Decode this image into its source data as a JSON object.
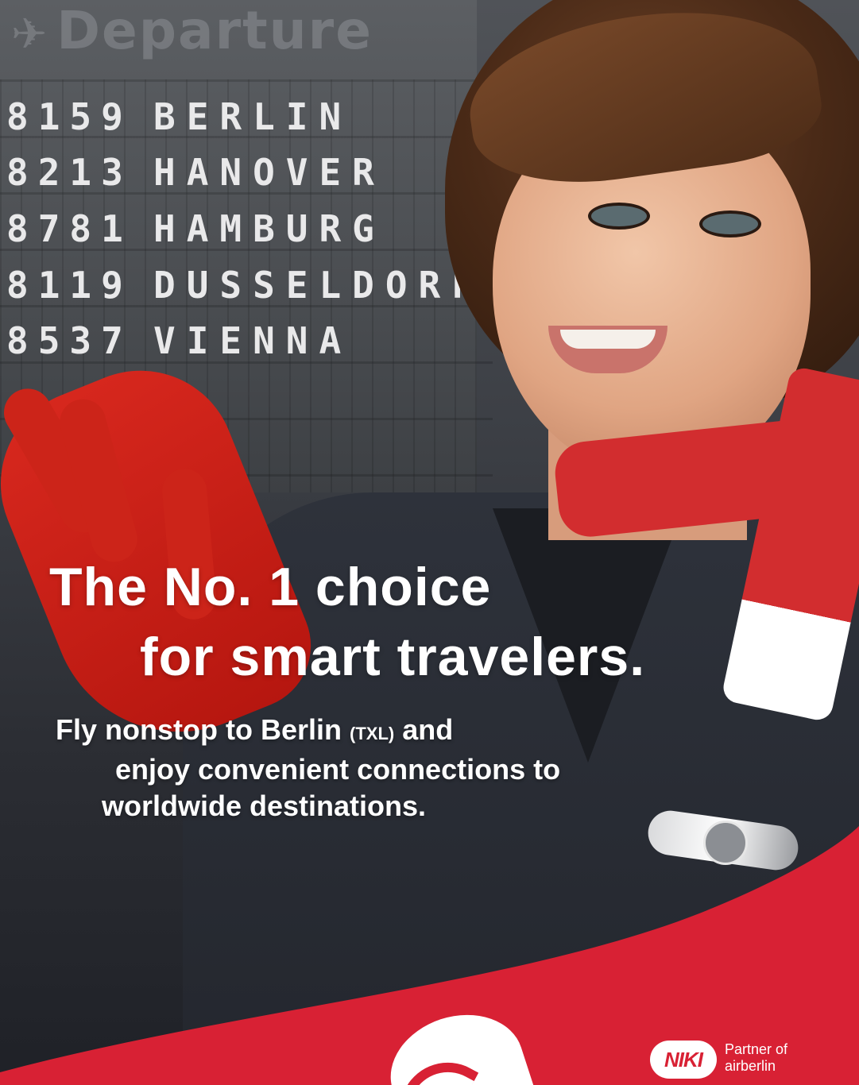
{
  "board": {
    "title": "Departure",
    "rows": [
      {
        "code": "8159",
        "city": "BERLIN"
      },
      {
        "code": "8213",
        "city": "HANOVER"
      },
      {
        "code": "8781",
        "city": "HAMBURG"
      },
      {
        "code": "8119",
        "city": "DUSSELDORF"
      },
      {
        "code": "8537",
        "city": "VIENNA"
      }
    ]
  },
  "headline": {
    "line1": "The No. 1 choice",
    "line2": "for smart travelers."
  },
  "subtext": {
    "line1_a": "Fly nonstop to Berlin",
    "line1_b": "(TXL)",
    "line1_c": "and",
    "line2": "enjoy convenient connections to",
    "line3": "worldwide destinations."
  },
  "brand": {
    "niki_logo_text": "NIKI",
    "partner_line1": "Partner of",
    "partner_line2": "airberlin",
    "accent_color": "#d82134"
  }
}
